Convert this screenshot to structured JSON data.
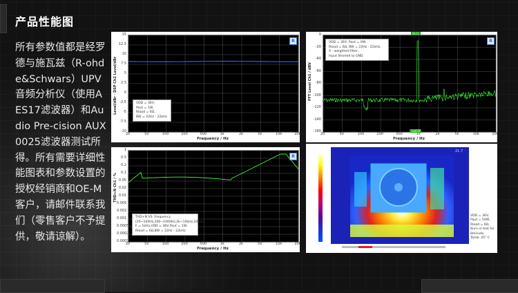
{
  "page": {
    "title": "产品性能图",
    "description": "所有参数值都是经罗德与施瓦兹（R-ohde&Schwars）UPV音频分析仪（使用AES17滤波器）和Audio Pre-cision AUX0025滤波器测试所得。所有需要详细性能图表和参数设置的授权经销商和OE-M客户，请邮件联系我们（零售客户不予提供，敬请谅解）。"
  },
  "panels": {
    "freq_response": {
      "ylabel": "Level/dBr · DSP Ch2 Level/dBr",
      "xlabel": "Frequency / Hz",
      "legend": [
        "VDD = 36V,",
        "Pout = 1W,",
        "Rload = 6Ω,",
        "BW = 22Hz - 22kHz"
      ],
      "yticks": [
        "15",
        "12.5",
        "10",
        "7.5",
        "5",
        "2.5",
        "0",
        "-2.5",
        "-5",
        "-7.5",
        "-10"
      ],
      "xticks": [
        "20",
        "50",
        "100",
        "200",
        "500",
        "1k",
        "2k",
        "5k",
        "10k",
        "20k"
      ]
    },
    "fft": {
      "ylabel": "FFT Level Ch1 / dBV",
      "xlabel": "Frequency / Hz",
      "legend": [
        "VDD = 36V, Pout = 0W,",
        "Rload = 6Ω, BW = 22Hz - 22kHz,",
        "A - weighted Filter,",
        "Input Shorted to GND"
      ],
      "yticks": [
        "0",
        "-20",
        "-40",
        "-60",
        "-80",
        "-100",
        "-120",
        "-140",
        "-160"
      ],
      "xticks": [
        "20",
        "50",
        "100",
        "200",
        "500",
        "1k",
        "2k",
        "5k",
        "10k",
        "20k"
      ],
      "marker_top": "6k11",
      "marker_bottom": "1k81M"
    },
    "thd": {
      "ylabel": "THD+N Ch1 / %",
      "xlabel": "Frequency / Hz",
      "legend": [
        "THD+N VS. Frequency",
        "(20~100Hz,200~1000Hz,2k~10kHz,20kHz)",
        "F = 1kHz,VDD = 36V,Pout = 1W,",
        "Rload = 6Ω,BW = 22Hz - 22kHz"
      ],
      "yticks": [
        "1",
        "0.5",
        "0.2",
        "0.1",
        "0.05",
        "0.02",
        "0.01",
        "0.005",
        "0.002",
        "0.001",
        "0.0005",
        "0.0002",
        "0.0001"
      ],
      "xticks": [
        "20",
        "50",
        "100",
        "200",
        "500",
        "1k",
        "2k",
        "5k",
        "10k",
        "20k"
      ]
    },
    "thermal": {
      "notes": [
        "VDD = 36V,",
        "Pout = 50W,",
        "Rload = 6Ω,",
        "Burn-in test for",
        "8minute,",
        "Tamb: 25° C"
      ],
      "corner_value": "21.7"
    }
  }
}
